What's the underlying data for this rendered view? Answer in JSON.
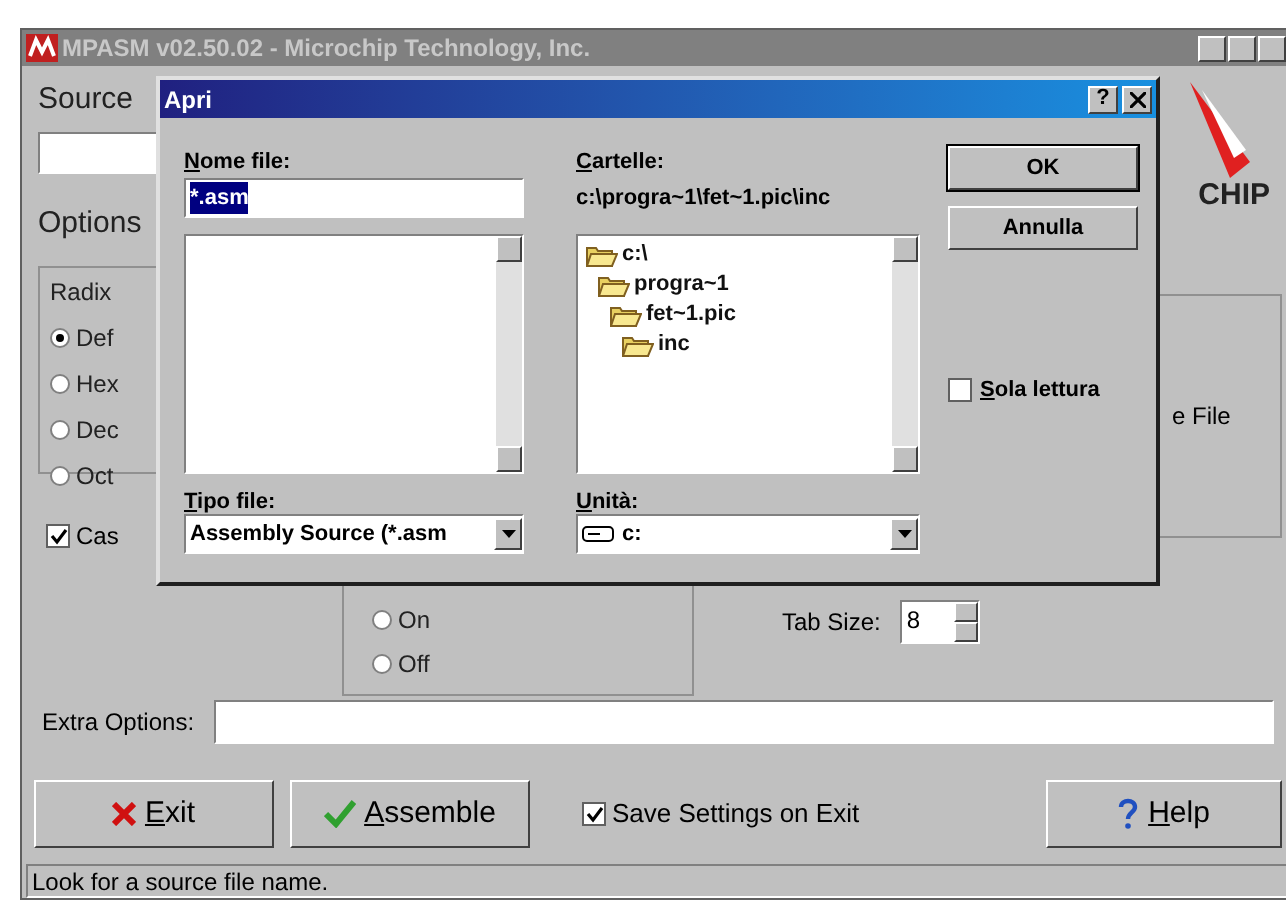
{
  "window": {
    "title": "MPASM v02.50.02 - Microchip Technology, Inc."
  },
  "source": {
    "label": "Source"
  },
  "logo": {
    "text": "CHIP"
  },
  "options": {
    "label": "Options"
  },
  "radix": {
    "label": "Radix",
    "items": [
      {
        "label": "Def",
        "selected": true
      },
      {
        "label": "Hex",
        "selected": false
      },
      {
        "label": "Dec",
        "selected": false
      },
      {
        "label": "Oct",
        "selected": false
      }
    ]
  },
  "case_checkbox": {
    "label": "Cas",
    "checked": true
  },
  "right_group": {
    "text": "e File"
  },
  "switch_group": {
    "items": [
      {
        "label": "On",
        "selected": false
      },
      {
        "label": "Off",
        "selected": false
      }
    ]
  },
  "tab_size": {
    "label": "Tab Size:",
    "value": "8"
  },
  "extra_options": {
    "label": "Extra Options:"
  },
  "buttons": [
    {
      "kind": "exit",
      "label": "Exit"
    },
    {
      "kind": "assemble",
      "label": "Assemble"
    }
  ],
  "save_settings": {
    "label": "Save Settings on Exit",
    "checked": true
  },
  "help_button": {
    "label": "Help"
  },
  "status_bar": "Look for a source file name.",
  "dialog": {
    "title": "Apri",
    "help": "?",
    "file_name": {
      "label": "Nome file:",
      "value": "*.asm",
      "selected": true
    },
    "folders": {
      "label": "Cartelle:",
      "path": "c:\\progra~1\\fet~1.pic\\inc",
      "tree": [
        {
          "label": "c:\\",
          "children": [
            {
              "label": "progra~1",
              "children": [
                {
                  "label": "fet~1.pic",
                  "children": [
                    {
                      "label": "inc"
                    }
                  ]
                }
              ]
            }
          ]
        }
      ]
    },
    "ok": "OK",
    "cancel": "Annulla",
    "read_only": {
      "label": "Sola lettura",
      "checked": false
    },
    "file_type": {
      "label": "Tipo file:",
      "value": "Assembly Source (*.asm"
    },
    "drive": {
      "label": "Unità:",
      "value": "c:"
    }
  }
}
